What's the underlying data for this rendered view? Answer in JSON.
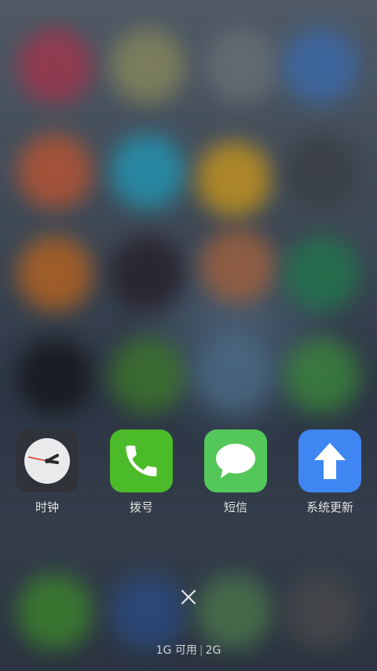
{
  "recent_apps": [
    {
      "label": "时钟",
      "icon": "clock-icon",
      "color": "#2f3238"
    },
    {
      "label": "拨号",
      "icon": "phone-icon",
      "color": "#4cbb29"
    },
    {
      "label": "短信",
      "icon": "message-icon",
      "color": "#54c75a"
    },
    {
      "label": "系统更新",
      "icon": "update-arrow-icon",
      "color": "#3f86f2"
    }
  ],
  "close_button": {
    "icon": "close-icon"
  },
  "memory": {
    "available": "1G 可用",
    "separator": "|",
    "total": "2G"
  }
}
